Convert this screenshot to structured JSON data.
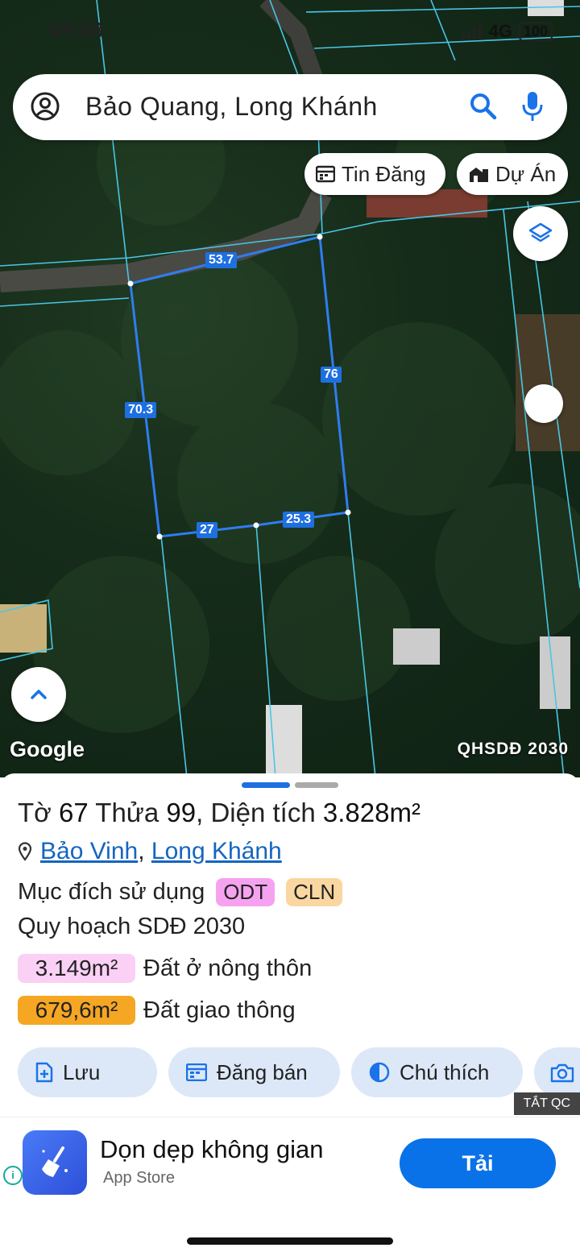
{
  "status_bar": {
    "time": "09:08",
    "network": "4G",
    "battery": "100"
  },
  "search": {
    "query": "Bảo Quang, Long Khánh"
  },
  "chips": {
    "tin_dang": "Tin Đăng",
    "du_an": "Dự Án"
  },
  "parcel_labels": {
    "top": "53.7",
    "right": "76",
    "left": "70.3",
    "bottom_left": "27",
    "bottom_right": "25.3"
  },
  "map_footer": {
    "google": "Google",
    "overlay": "QHSDĐ 2030"
  },
  "sheet": {
    "title_prefix": "Tờ",
    "to_number": "67",
    "thua_label": "Thửa",
    "thua_number": "99",
    "area_label": ", Diện tích",
    "area_value": "3.828m²",
    "location": {
      "ward": "Bảo Vinh",
      "separator": ",",
      "city": "Long Khánh"
    },
    "purpose_label": "Mục đích sử dụng",
    "purpose_tags": [
      {
        "code": "ODT",
        "color": "#f5a3f0"
      },
      {
        "code": "CLN",
        "color": "#fad7a0"
      }
    ],
    "plan_label": "Quy hoạch SDĐ 2030",
    "plan_areas": [
      {
        "value": "3.149m²",
        "desc": "Đất ở nông thôn",
        "color": "#fbd0f5"
      },
      {
        "value": "679,6m²",
        "desc": "Đất giao thông",
        "color": "#f5a623"
      }
    ],
    "actions": {
      "save": "Lưu",
      "post": "Đăng bán",
      "legend": "Chú thích"
    }
  },
  "ad": {
    "close_label": "TẮT QC",
    "app_name": "Dọn dẹp không gian",
    "store": "App Store",
    "button": "Tải"
  },
  "colors": {
    "accent": "#1e6fe0",
    "action_bg": "#dce8f8",
    "ad_button": "#0a72e8"
  }
}
